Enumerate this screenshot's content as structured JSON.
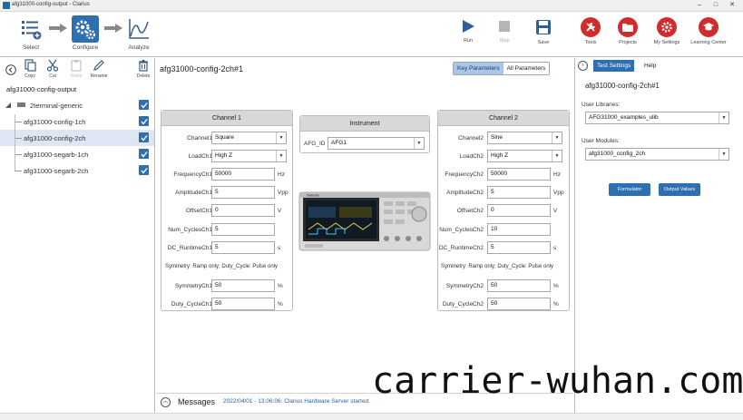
{
  "window": {
    "title": "afg31000-config-output - Clarius",
    "controls": [
      "–",
      "□",
      "✕"
    ]
  },
  "toolbar": {
    "workflow": [
      {
        "label": "Select",
        "icon": "list-add-icon"
      },
      {
        "label": "Configure",
        "icon": "gears-icon"
      },
      {
        "label": "Analyze",
        "icon": "chart-icon"
      }
    ],
    "actions": [
      {
        "label": "Run",
        "icon": "play-icon",
        "enabled": true
      },
      {
        "label": "Stop",
        "icon": "stop-icon",
        "enabled": false
      },
      {
        "label": "Save",
        "icon": "save-icon",
        "enabled": true
      }
    ],
    "nav": [
      {
        "label": "Tools",
        "icon": "wrench-icon"
      },
      {
        "label": "Projects",
        "icon": "folder-icon"
      },
      {
        "label": "My Settings",
        "icon": "gear-icon"
      },
      {
        "label": "Learning Center",
        "icon": "graduation-cap-icon"
      }
    ]
  },
  "left": {
    "tools": [
      {
        "label": "Copy",
        "enabled": true
      },
      {
        "label": "Cut",
        "enabled": true
      },
      {
        "label": "Paste",
        "enabled": false
      },
      {
        "label": "Rename",
        "enabled": true
      },
      {
        "label": "Delete",
        "enabled": true
      }
    ],
    "root": "afg31000-config-output",
    "tree": [
      {
        "label": "2terminal-generic",
        "checked": true,
        "selected": false,
        "level": 0
      },
      {
        "label": "afg31000-config-1ch",
        "checked": true,
        "selected": false,
        "level": 1
      },
      {
        "label": "afg31000-config-2ch",
        "checked": true,
        "selected": true,
        "level": 1
      },
      {
        "label": "afg31000-segarb-1ch",
        "checked": true,
        "selected": false,
        "level": 1
      },
      {
        "label": "afg31000-segarb-2ch",
        "checked": true,
        "selected": false,
        "level": 1
      }
    ]
  },
  "center": {
    "title": "afg31000-config-2ch#1",
    "tabs": [
      {
        "label": "Key Parameters",
        "active": true
      },
      {
        "label": "All Parameters",
        "active": false
      }
    ],
    "instrument": {
      "header": "Instrument",
      "label": "AFG_ID",
      "value": "AFG1"
    },
    "channel1": {
      "header": "Channel 1",
      "channel_label": "Channel1",
      "channel_value": "Square",
      "load_label": "LoadCh1",
      "load_value": "High Z",
      "freq_label": "FrequencyCh1",
      "freq_value": "50000",
      "freq_unit": "Hz",
      "amp_label": "AmplitudeCh1",
      "amp_value": "5",
      "amp_unit": "Vpp",
      "offset_label": "OffsetCh1",
      "offset_value": "0",
      "offset_unit": "V",
      "cycles_label": "Num_CyclesCh1",
      "cycles_value": "5",
      "runtime_label": "DC_RuntimeCh1",
      "runtime_value": "5",
      "runtime_unit": "s",
      "note": "Symmetry: Ramp only; Duty_Cycle: Pulse only",
      "sym_label": "SymmetryCh1",
      "sym_value": "50",
      "sym_unit": "%",
      "duty_label": "Duty_CycleCh1",
      "duty_value": "50",
      "duty_unit": "%"
    },
    "channel2": {
      "header": "Channel 2",
      "channel_label": "Channel2",
      "channel_value": "Sine",
      "load_label": "LoadCh2",
      "load_value": "High Z",
      "freq_label": "FrequencyCh2",
      "freq_value": "50000",
      "freq_unit": "Hz",
      "amp_label": "AmplitudeCh2",
      "amp_value": "5",
      "amp_unit": "Vpp",
      "offset_label": "OffsetCh2",
      "offset_value": "0",
      "offset_unit": "V",
      "cycles_label": "Num_CyclesCh2",
      "cycles_value": "10",
      "runtime_label": "DC_RuntimeCh2",
      "runtime_value": "5",
      "runtime_unit": "s",
      "note": "Symmetry: Ramp only; Duty_Cycle: Pulse only",
      "sym_label": "SymmetryCh2",
      "sym_value": "50",
      "sym_unit": "%",
      "duty_label": "Duty_CycleCh2",
      "duty_value": "50",
      "duty_unit": "%"
    },
    "device_brand": "Tektronix"
  },
  "messages": {
    "title": "Messages",
    "text": "2022/04/01 - 13:06:06: Clarius Hardware Server started."
  },
  "right": {
    "tabs": [
      {
        "label": "Test Settings",
        "active": true
      },
      {
        "label": "Help",
        "active": false
      }
    ],
    "title": "afg31000-config-2ch#1",
    "libraries_label": "User Libraries:",
    "libraries_value": "AFG31000_examples_ulib",
    "modules_label": "User Modules:",
    "modules_value": "afg31000_config_2ch",
    "formulator": "Formulator",
    "output_values": "Output Values"
  },
  "watermark": "carrier-wuhan.com",
  "colors": {
    "accent": "#2e6fb0",
    "nav_red": "#d22b2b",
    "tab_active": "#a9c6e6"
  }
}
